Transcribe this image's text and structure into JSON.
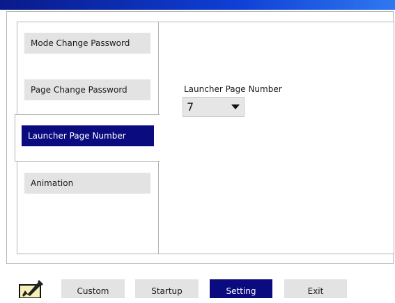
{
  "sidebar": {
    "items": [
      {
        "label": "Mode Change Password"
      },
      {
        "label": "Page Change Password"
      },
      {
        "label": "Launcher Page Number"
      },
      {
        "label": "Animation"
      }
    ]
  },
  "content": {
    "field_label": "Launcher Page Number",
    "dropdown_value": "7"
  },
  "bottom_bar": {
    "icon": "edit-pen-icon",
    "buttons": [
      {
        "label": "Custom"
      },
      {
        "label": "Startup"
      },
      {
        "label": "Setting"
      },
      {
        "label": "Exit"
      }
    ]
  },
  "colors": {
    "accent": "#0b0b80",
    "button_bg": "#e3e3e3",
    "title_bar": "#0f3fd6"
  }
}
